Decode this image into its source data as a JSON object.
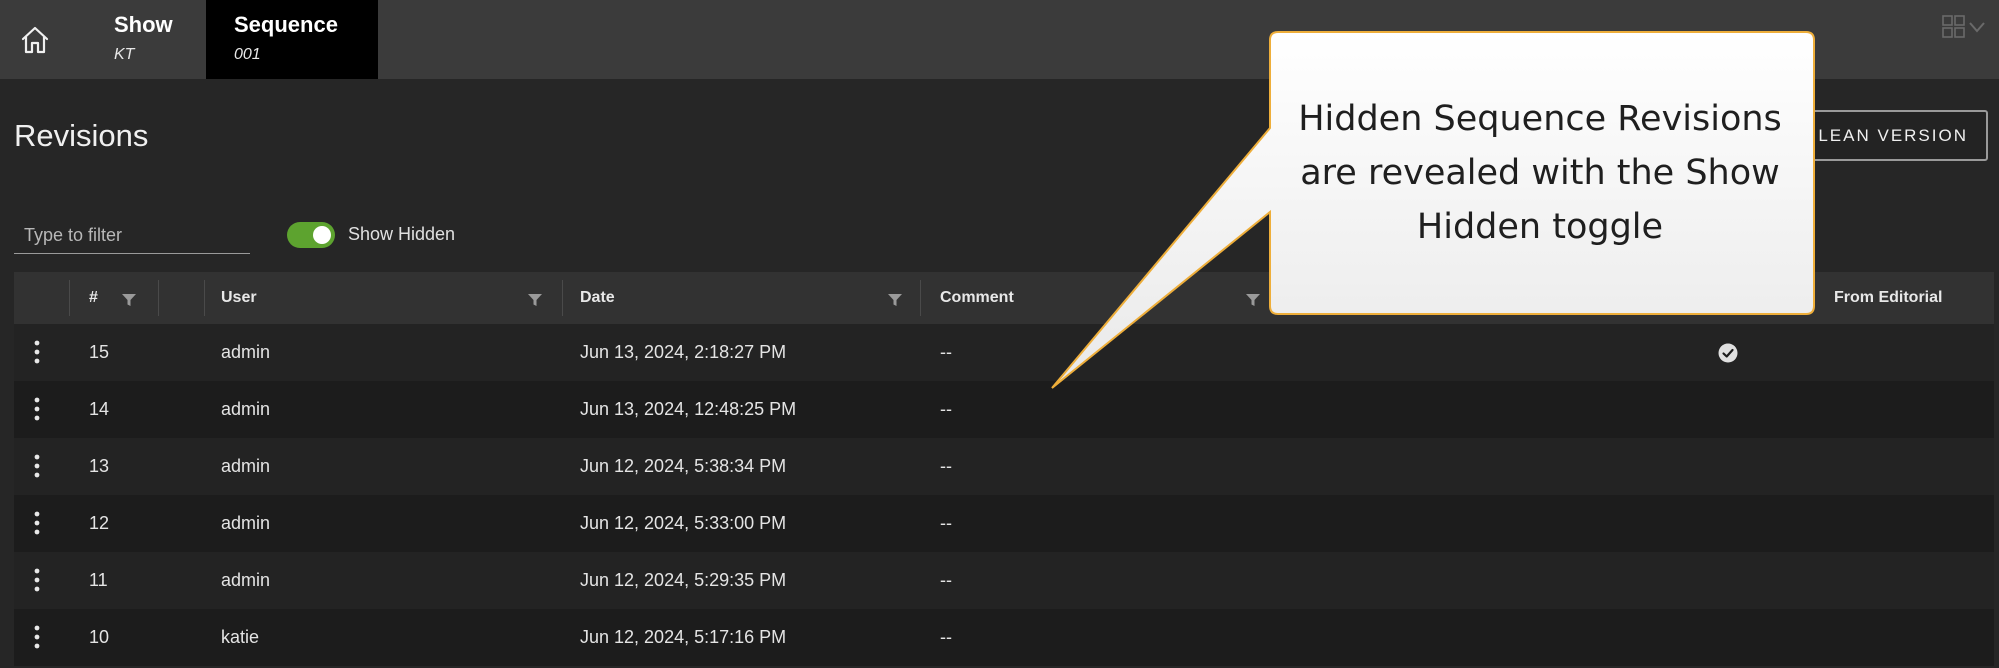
{
  "nav": {
    "breadcrumbs": [
      {
        "title": "Show",
        "subtitle": "KT"
      },
      {
        "title": "Sequence",
        "subtitle": "001"
      }
    ]
  },
  "page": {
    "title": "Revisions",
    "lean_button_label": "LEAN VERSION"
  },
  "filter": {
    "placeholder": "Type to filter",
    "value": ""
  },
  "show_hidden": {
    "label": "Show Hidden",
    "on": true,
    "color": "#5da32f"
  },
  "table": {
    "columns": [
      "#",
      "User",
      "Date",
      "Comment",
      "From Editorial"
    ],
    "rows": [
      {
        "num": "15",
        "user": "admin",
        "date": "Jun 13, 2024, 2:18:27 PM",
        "comment": "--",
        "from_editorial": true
      },
      {
        "num": "14",
        "user": "admin",
        "date": "Jun 13, 2024, 12:48:25 PM",
        "comment": "--",
        "from_editorial": false
      },
      {
        "num": "13",
        "user": "admin",
        "date": "Jun 12, 2024, 5:38:34 PM",
        "comment": "--",
        "from_editorial": false
      },
      {
        "num": "12",
        "user": "admin",
        "date": "Jun 12, 2024, 5:33:00 PM",
        "comment": "--",
        "from_editorial": false
      },
      {
        "num": "11",
        "user": "admin",
        "date": "Jun 12, 2024, 5:29:35 PM",
        "comment": "--",
        "from_editorial": false
      },
      {
        "num": "10",
        "user": "katie",
        "date": "Jun 12, 2024, 5:17:16 PM",
        "comment": "--",
        "from_editorial": false
      }
    ]
  },
  "callout": {
    "lines": [
      "Hidden Sequence Revisions",
      "are revealed with the Show",
      "Hidden toggle"
    ]
  },
  "icons": {
    "home": "home-icon",
    "grid_menu": "grid-menu-icon",
    "filter": "filter-icon",
    "row_menu": "more-vertical-icon",
    "check": "check-circle-icon"
  }
}
